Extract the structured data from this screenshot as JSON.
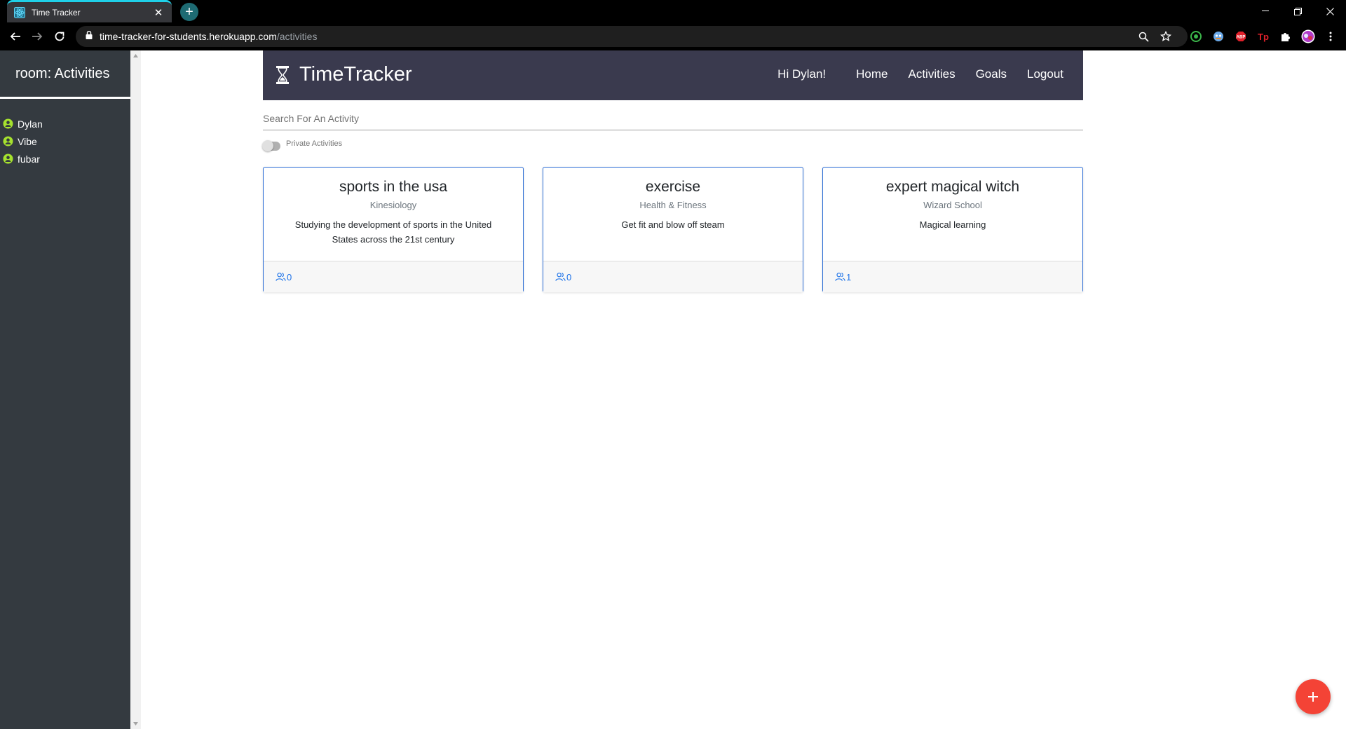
{
  "browser": {
    "tab_title": "Time Tracker",
    "url_host": "time-tracker-for-students.herokuapp.com",
    "url_path": "/activities",
    "accent": "#1fd0e8"
  },
  "sidebar": {
    "title": "room: Activities",
    "users": [
      {
        "name": "Dylan",
        "status_color": "#a6e22e"
      },
      {
        "name": "Vibe",
        "status_color": "#a6e22e"
      },
      {
        "name": "fubar",
        "status_color": "#a6e22e"
      }
    ]
  },
  "navbar": {
    "brand": "TimeTracker",
    "greeting": "Hi Dylan!",
    "links": [
      "Home",
      "Activities",
      "Goals",
      "Logout"
    ],
    "background": "#3a3a4e"
  },
  "search": {
    "placeholder": "Search For An Activity"
  },
  "toggle": {
    "label": "Private Activities",
    "checked": false
  },
  "activities": [
    {
      "title": "sports in the usa",
      "category": "Kinesiology",
      "description": "Studying the development of sports in the United States across the 21st century",
      "members": "0"
    },
    {
      "title": "exercise",
      "category": "Health & Fitness",
      "description": "Get fit and blow off steam",
      "members": "0"
    },
    {
      "title": "expert magical witch",
      "category": "Wizard School",
      "description": "Magical learning",
      "members": "1"
    }
  ],
  "colors": {
    "card_border": "#2f6fd6",
    "link_blue": "#1e73e8",
    "fab": "#f44336"
  }
}
